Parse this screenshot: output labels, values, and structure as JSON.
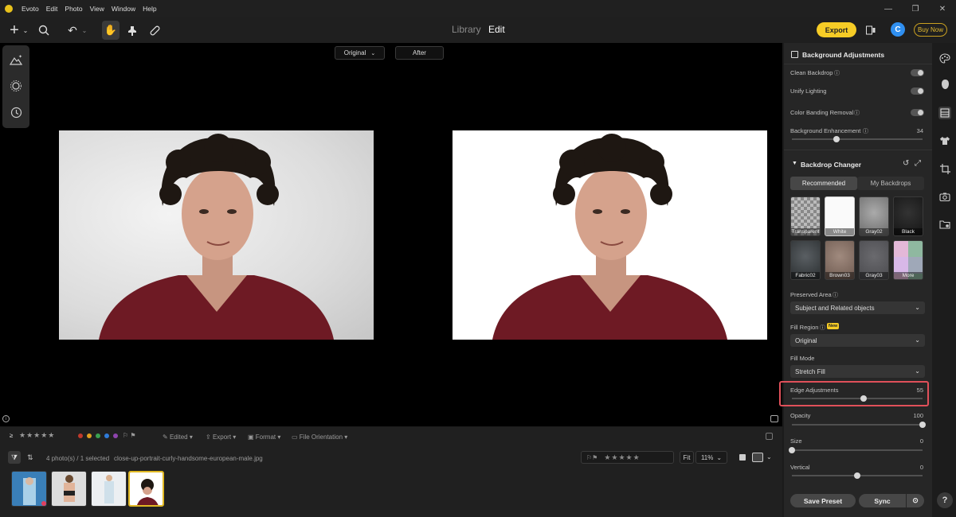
{
  "app": {
    "name": "Evoto"
  },
  "menu": [
    "Evoto",
    "Edit",
    "Photo",
    "View",
    "Window",
    "Help"
  ],
  "toolbar": {
    "library_tab": "Library",
    "edit_tab": "Edit",
    "export_label": "Export",
    "buy_label": "Buy Now",
    "avatar_letter": "C"
  },
  "view": {
    "original_label": "Original",
    "after_label": "After"
  },
  "filmstrip": {
    "edited_label": "Edited",
    "export_label": "Export",
    "format_label": "Format",
    "orientation_label": "File Orientation",
    "count_label": "4 photo(s) / 1 selected",
    "filename": "close-up-portrait-curly-handsome-european-male.jpg",
    "fit_label": "Fit",
    "zoom": "11%",
    "color_labels": [
      "#c0392b",
      "#e0a020",
      "#3aa050",
      "#2f7bd8",
      "#8e44ad"
    ]
  },
  "panel": {
    "bg_adjust_title": "Background Adjustments",
    "clean_backdrop": "Clean Backdrop",
    "unify_lighting": "Unify Lighting",
    "color_banding": "Color Banding Removal",
    "bg_enhance": "Background Enhancement",
    "bg_enhance_value": "34",
    "backdrop_title": "Backdrop Changer",
    "tab_recommended": "Recommended",
    "tab_my": "My Backdrops",
    "backdrops": [
      "Transparent",
      "White",
      "Gray02",
      "Black",
      "Fabric02",
      "Brown03",
      "Gray03",
      "More"
    ],
    "preserved_label": "Preserved Area",
    "preserved_value": "Subject and Related objects",
    "fill_region_label": "Fill Region",
    "new_badge": "New",
    "fill_region_value": "Original",
    "fill_mode_label": "Fill Mode",
    "fill_mode_value": "Stretch Fill",
    "edge_label": "Edge Adjustments",
    "edge_value": "55",
    "opacity_label": "Opacity",
    "opacity_value": "100",
    "size_label": "Size",
    "size_value": "0",
    "vertical_label": "Vertical",
    "vertical_value": "0",
    "save_preset": "Save Preset",
    "sync": "Sync",
    "slider_levels": {
      "bg_enhance": 0.34,
      "edge": 0.55,
      "opacity": 1.0,
      "size": 0.0,
      "vertical": 0.5
    }
  },
  "colors": {
    "accent": "#f6cc26",
    "highlight": "#e0505a",
    "shirt": "#6e1a24"
  }
}
